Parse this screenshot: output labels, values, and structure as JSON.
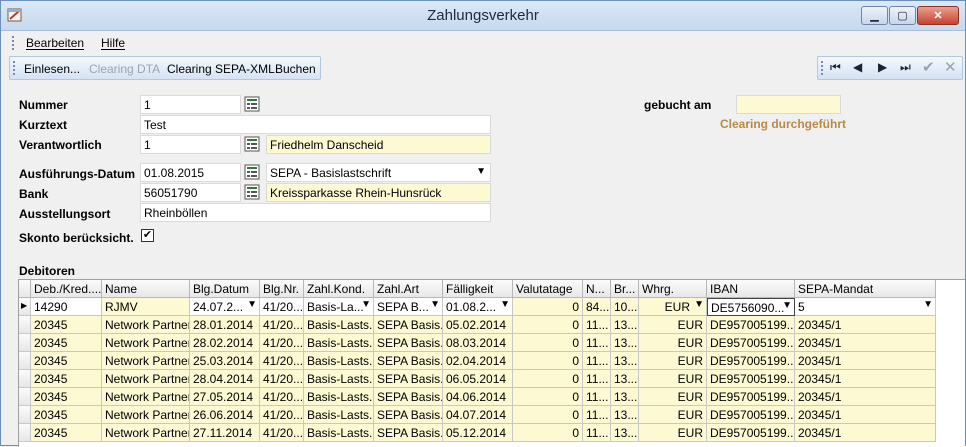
{
  "window": {
    "title": "Zahlungsverkehr"
  },
  "menu": {
    "items": [
      "Bearbeiten",
      "Hilfe"
    ]
  },
  "toolbar": {
    "einlesen": "Einlesen...",
    "clearing_dta": "Clearing DTA",
    "clearing_sepa": "Clearing SEPA-XML",
    "buchen": "Buchen"
  },
  "form": {
    "nummer_label": "Nummer",
    "nummer_value": "1",
    "kurztext_label": "Kurztext",
    "kurztext_value": "Test",
    "verantwortlich_label": "Verantwortlich",
    "verantwortlich_value": "1",
    "verantwortlich_name": "Friedhelm Danscheid",
    "ausfuehrung_label": "Ausführungs-Datum",
    "ausfuehrung_value": "01.08.2015",
    "zahlart_value": "SEPA - Basislastschrift",
    "bank_label": "Bank",
    "bank_value": "56051790",
    "bank_name": "Kreissparkasse Rhein-Hunsrück",
    "ausstellungsort_label": "Ausstellungsort",
    "ausstellungsort_value": "Rheinböllen",
    "skonto_label": "Skonto berücksicht.",
    "skonto_checked": "✔",
    "gebucht_label": "gebucht am",
    "gebucht_value": "",
    "status": "Clearing durchgeführt"
  },
  "grid": {
    "section_label": "Debitoren",
    "headers": [
      "Deb./Kred....",
      "Name",
      "Blg.Datum",
      "Blg.Nr.",
      "Zahl.Kond.",
      "Zahl.Art",
      "Fälligkeit",
      "Valutatage",
      "N...",
      "Br...",
      "Whrg.",
      "IBAN",
      "SEPA-Mandat"
    ],
    "rows": [
      [
        "14290",
        "RJMV",
        "24.07.2...",
        "41/20...",
        "Basis-La...",
        "SEPA B...",
        "01.08.2...",
        "0",
        "84...",
        "10...",
        "EUR",
        "DE5756090...",
        "5"
      ],
      [
        "20345",
        "Network Partner...",
        "28.01.2014",
        "41/20...",
        "Basis-Lasts...",
        "SEPA Basis...",
        "05.02.2014",
        "0",
        "11...",
        "13...",
        "EUR",
        "DE957005199...",
        "20345/1"
      ],
      [
        "20345",
        "Network Partner...",
        "28.02.2014",
        "41/20...",
        "Basis-Lasts...",
        "SEPA Basis...",
        "08.03.2014",
        "0",
        "11...",
        "13...",
        "EUR",
        "DE957005199...",
        "20345/1"
      ],
      [
        "20345",
        "Network Partner...",
        "25.03.2014",
        "41/20...",
        "Basis-Lasts...",
        "SEPA Basis...",
        "02.04.2014",
        "0",
        "11...",
        "13...",
        "EUR",
        "DE957005199...",
        "20345/1"
      ],
      [
        "20345",
        "Network Partner...",
        "28.04.2014",
        "41/20...",
        "Basis-Lasts...",
        "SEPA Basis...",
        "06.05.2014",
        "0",
        "11...",
        "13...",
        "EUR",
        "DE957005199...",
        "20345/1"
      ],
      [
        "20345",
        "Network Partner...",
        "27.05.2014",
        "41/20...",
        "Basis-Lasts...",
        "SEPA Basis...",
        "04.06.2014",
        "0",
        "11...",
        "13...",
        "EUR",
        "DE957005199...",
        "20345/1"
      ],
      [
        "20345",
        "Network Partner...",
        "26.06.2014",
        "41/20...",
        "Basis-Lasts...",
        "SEPA Basis...",
        "04.07.2014",
        "0",
        "11...",
        "13...",
        "EUR",
        "DE957005199...",
        "20345/1"
      ],
      [
        "20345",
        "Network Partner...",
        "27.11.2014",
        "41/20...",
        "Basis-Lasts...",
        "SEPA Basis...",
        "05.12.2014",
        "0",
        "11...",
        "13...",
        "EUR",
        "DE957005199...",
        "20345/1"
      ]
    ]
  },
  "colors": {
    "accent": "#b98a45",
    "readonly_bg": "#fcf9d3"
  }
}
